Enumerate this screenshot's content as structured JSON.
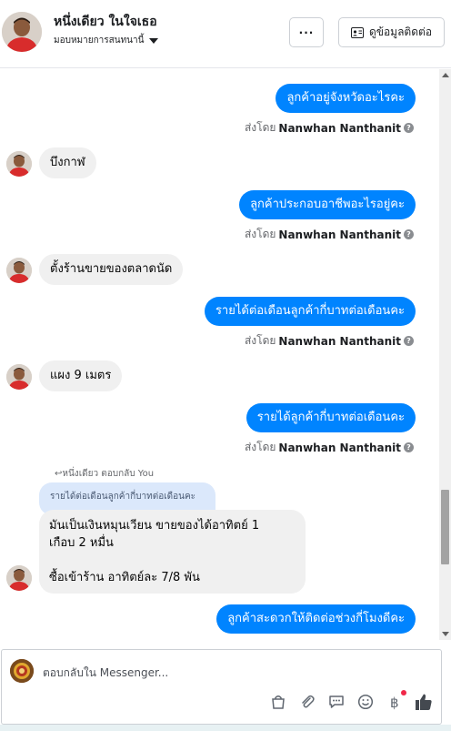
{
  "header": {
    "contact_name": "หนึ่งเดียว ในใจเธอ",
    "assign_label": "มอบหมายการสนทนานี้",
    "more_label": "···",
    "contact_info_label": "ดูข้อมูลติดต่อ"
  },
  "messages": [
    {
      "type": "out",
      "text": "ลูกค้าอยู่จังหวัดอะไรคะ",
      "sent_by_prefix": "ส่งโดย",
      "sent_by_name": "Nanwhan Nanthanit"
    },
    {
      "type": "in",
      "text": "บึงกาฬ"
    },
    {
      "type": "out",
      "text": "ลูกค้าประกอบอาชีพอะไรอยู่คะ",
      "sent_by_prefix": "ส่งโดย",
      "sent_by_name": "Nanwhan Nanthanit"
    },
    {
      "type": "in",
      "text": "ตั้งร้านขายของตลาดนัด"
    },
    {
      "type": "out",
      "text": "รายได้ต่อเดือนลูกค้ากี่บาทต่อเดือนคะ",
      "sent_by_prefix": "ส่งโดย",
      "sent_by_name": "Nanwhan Nanthanit"
    },
    {
      "type": "in",
      "text": "แผง 9 เมตร"
    },
    {
      "type": "out",
      "text": "รายได้ลูกค้ากี่บาทต่อเดือนคะ",
      "sent_by_prefix": "ส่งโดย",
      "sent_by_name": "Nanwhan Nanthanit"
    },
    {
      "type": "reply",
      "reply_label": "↩หนึ่งเดียว ตอบกลับ You",
      "quoted": "รายได้ต่อเดือนลูกค้ากี่บาทต่อเดือนคะ",
      "line1": "มันเป็นเงินหมุนเวียน ขายของได้อาทิตย์ 1",
      "line2": "เกือบ 2 หมื่น",
      "line3": "ซื้อเข้าร้าน อาทิตย์ละ 7/8 พัน"
    },
    {
      "type": "out",
      "text": "ลูกค้าสะดวกให้ติดต่อช่วงกี่โมงดีคะ"
    }
  ],
  "composer": {
    "placeholder": "ตอบกลับใน Messenger..."
  },
  "tools": [
    "bag-icon",
    "paperclip-icon",
    "saved-reply-icon",
    "emoji-icon",
    "baht-icon",
    "thumbs-up-icon"
  ]
}
